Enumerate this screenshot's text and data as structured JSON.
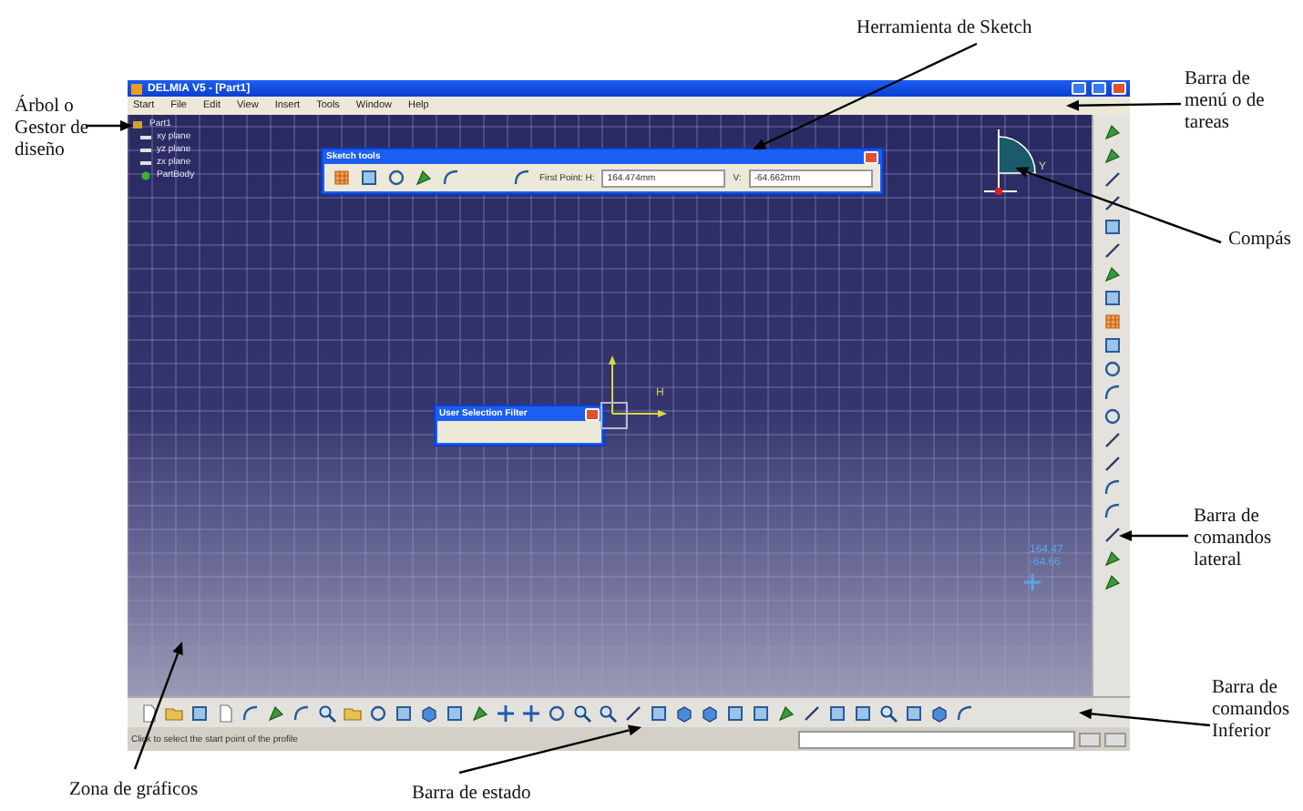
{
  "window": {
    "title": "DELMIA V5 - [Part1]"
  },
  "menu": [
    "Start",
    "File",
    "Edit",
    "View",
    "Insert",
    "Tools",
    "Window",
    "Help"
  ],
  "tree": [
    {
      "label": "Part1",
      "children": [
        {
          "label": "xy plane",
          "kind": "plane"
        },
        {
          "label": "yz plane",
          "kind": "plane"
        },
        {
          "label": "zx plane",
          "kind": "plane"
        },
        {
          "label": "PartBody",
          "kind": "body"
        }
      ]
    }
  ],
  "sketch_tools": {
    "title": "Sketch tools",
    "first_point_label": "First Point: H:",
    "h_value": "164.474mm",
    "v_label": "V:",
    "v_value": "-64.662mm"
  },
  "selection_filter": {
    "title": "User Selection Filter"
  },
  "axes": {
    "h_label": "H"
  },
  "compass": {
    "label": "Y"
  },
  "cursor_readout": [
    "164.47",
    "-64.66"
  ],
  "status_bar": {
    "message": "Click to select the start point of the profile"
  },
  "annotations": [
    {
      "text": "Herramienta de Sketch"
    },
    {
      "text": "Árbol o Gestor de diseño"
    },
    {
      "text": "Barra de menú o de tareas"
    },
    {
      "text": "Compás"
    },
    {
      "text": "Barra de comandos lateral"
    },
    {
      "text": "Barra de comandos Inferior"
    },
    {
      "text": "Zona de gráficos"
    },
    {
      "text": "Barra de estado"
    }
  ]
}
